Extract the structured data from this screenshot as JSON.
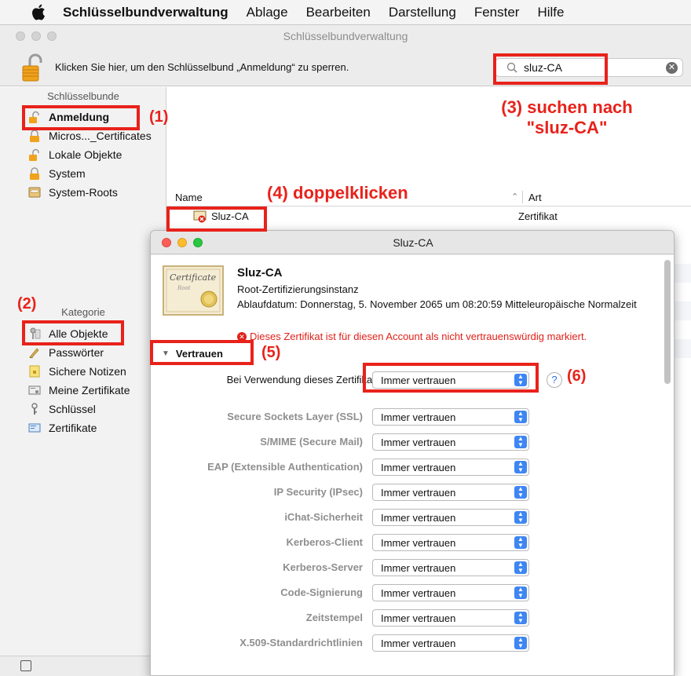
{
  "menubar": {
    "app": "Schlüsselbundverwaltung",
    "items": [
      "Ablage",
      "Bearbeiten",
      "Darstellung",
      "Fenster",
      "Hilfe"
    ]
  },
  "window": {
    "title": "Schlüsselbundverwaltung",
    "lock_message": "Klicken Sie hier, um den Schlüsselbund „Anmeldung“ zu sperren.",
    "search_value": "sluz-CA"
  },
  "sidebar": {
    "keychains_header": "Schlüsselbunde",
    "keychains": [
      "Anmeldung",
      "Micros..._Certificates",
      "Lokale Objekte",
      "System",
      "System-Roots"
    ],
    "category_header": "Kategorie",
    "categories": [
      "Alle Objekte",
      "Passwörter",
      "Sichere Notizen",
      "Meine Zertifikate",
      "Schlüssel",
      "Zertifikate"
    ]
  },
  "list": {
    "col_name": "Name",
    "col_kind": "Art",
    "row_name": "Sluz-CA",
    "row_kind": "Zertifikat"
  },
  "dialog": {
    "title": "Sluz-CA",
    "cert_name": "Sluz-CA",
    "cert_type": "Root-Zertifizierungsinstanz",
    "expiry": "Ablaufdatum: Donnerstag, 5. November 2065 um 08:20:59 Mitteleuropäische Normalzeit",
    "warning": "Dieses Zertifikat ist für diesen Account als nicht vertrauenswürdig markiert.",
    "trust_header": "Vertrauen",
    "main_label": "Bei Verwendung dieses Zertifikats:",
    "main_value": "Immer vertrauen",
    "help_label": "?",
    "rows": [
      {
        "label": "Secure Sockets Layer (SSL)",
        "value": "Immer vertrauen"
      },
      {
        "label": "S/MIME (Secure Mail)",
        "value": "Immer vertrauen"
      },
      {
        "label": "EAP (Extensible Authentication)",
        "value": "Immer vertrauen"
      },
      {
        "label": "IP Security (IPsec)",
        "value": "Immer vertrauen"
      },
      {
        "label": "iChat-Sicherheit",
        "value": "Immer vertrauen"
      },
      {
        "label": "Kerberos-Client",
        "value": "Immer vertrauen"
      },
      {
        "label": "Kerberos-Server",
        "value": "Immer vertrauen"
      },
      {
        "label": "Code-Signierung",
        "value": "Immer vertrauen"
      },
      {
        "label": "Zeitstempel",
        "value": "Immer vertrauen"
      },
      {
        "label": "X.509-Standardrichtlinien",
        "value": "Immer vertrauen"
      }
    ]
  },
  "annotations": {
    "a1": "(1)",
    "a2": "(2)",
    "a3_line1": "(3) suchen nach",
    "a3_line2": "\"sluz-CA\"",
    "a4": "(4) doppelklicken",
    "a5": "(5)",
    "a6": "(6)"
  },
  "colors": {
    "annotation": "#e8221b",
    "stepper": "#3e86f3",
    "warning": "#e02018"
  }
}
